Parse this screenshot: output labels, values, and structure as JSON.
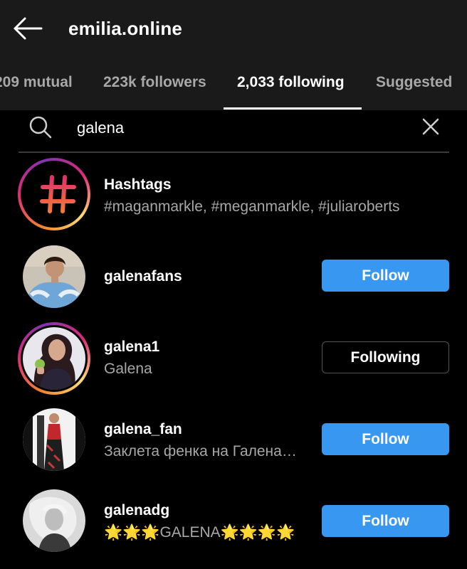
{
  "header": {
    "back_icon": "arrow-left-icon",
    "title": "emilia.online"
  },
  "tabs": [
    {
      "label": "209 mutual",
      "active": false
    },
    {
      "label": "223k followers",
      "active": false
    },
    {
      "label": "2,033 following",
      "active": true
    },
    {
      "label": "Suggested",
      "active": false
    }
  ],
  "search": {
    "value": "galena",
    "icon": "search-icon",
    "clear_icon": "close-icon"
  },
  "hashtags": {
    "title": "Hashtags",
    "subtitle": "#maganmarkle, #meganmarkle, #juliaroberts"
  },
  "results": [
    {
      "username": "galenafans",
      "subtitle": "",
      "button": "Follow",
      "story_ring": false
    },
    {
      "username": "galena1",
      "subtitle": "Galena",
      "button": "Following",
      "story_ring": true
    },
    {
      "username": "galena_fan",
      "subtitle": "Заклета фенка на Галена…",
      "button": "Follow",
      "story_ring": false
    },
    {
      "username": "galenadg",
      "subtitle": "🌟🌟🌟GALENA🌟🌟🌟🌟",
      "button": "Follow",
      "story_ring": false
    }
  ],
  "colors": {
    "follow_button": "#3897f0",
    "header_bg": "#1a1a1a",
    "secondary_text": "#a8a8a8"
  }
}
